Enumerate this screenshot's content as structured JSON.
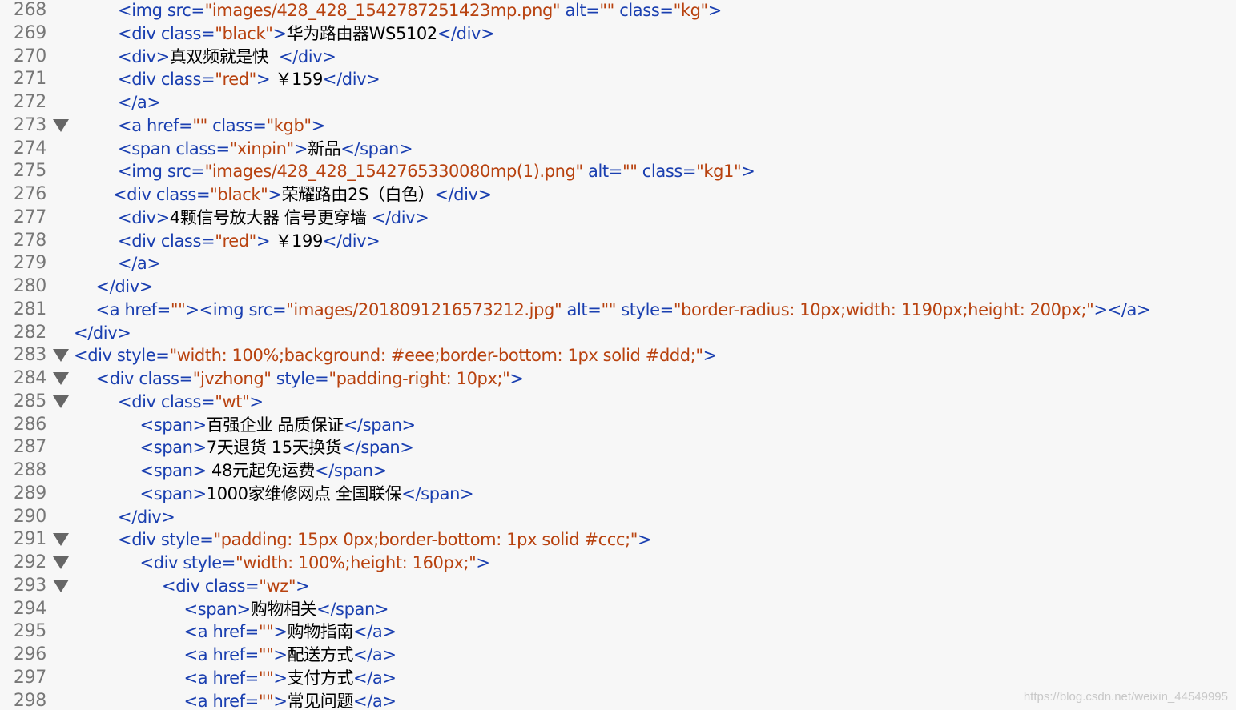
{
  "colors": {
    "background": "#f7f7f7",
    "line_number": "#777777",
    "tag": "#1a3fb0",
    "string": "#b8420f",
    "text": "#000000",
    "watermark": "#c8c8c8"
  },
  "icons": {
    "fold_marker": "fold-triangle-icon"
  },
  "editor": {
    "lines": [
      {
        "num": "268",
        "fold": false,
        "indent": 2,
        "tokens": [
          [
            "tag",
            "<img "
          ],
          [
            "attr",
            "src="
          ],
          [
            "str",
            "\"images/428_428_1542787251423mp.png\""
          ],
          [
            "attr",
            " alt="
          ],
          [
            "str",
            "\"\""
          ],
          [
            "attr",
            " class="
          ],
          [
            "str",
            "\"kg\""
          ],
          [
            "tag",
            ">"
          ]
        ]
      },
      {
        "num": "269",
        "fold": false,
        "indent": 2,
        "tokens": [
          [
            "tag",
            "<div "
          ],
          [
            "attr",
            "class="
          ],
          [
            "str",
            "\"black\""
          ],
          [
            "tag",
            ">"
          ],
          [
            "txt",
            "华为路由器WS5102"
          ],
          [
            "tag",
            "</div>"
          ]
        ]
      },
      {
        "num": "270",
        "fold": false,
        "indent": 2,
        "tokens": [
          [
            "tag",
            "<div>"
          ],
          [
            "txt",
            "真双频就是快  "
          ],
          [
            "tag",
            "</div>"
          ]
        ]
      },
      {
        "num": "271",
        "fold": false,
        "indent": 2,
        "tokens": [
          [
            "tag",
            "<div "
          ],
          [
            "attr",
            "class="
          ],
          [
            "str",
            "\"red\""
          ],
          [
            "tag",
            "> "
          ],
          [
            "txt",
            "￥159"
          ],
          [
            "tag",
            "</div>"
          ]
        ]
      },
      {
        "num": "272",
        "fold": false,
        "indent": 2,
        "tokens": [
          [
            "tag",
            "</a>"
          ]
        ]
      },
      {
        "num": "273",
        "fold": true,
        "indent": 2,
        "tokens": [
          [
            "tag",
            "<a "
          ],
          [
            "attr",
            "href="
          ],
          [
            "str",
            "\"\""
          ],
          [
            "attr",
            " class="
          ],
          [
            "str",
            "\"kgb\""
          ],
          [
            "tag",
            ">"
          ]
        ]
      },
      {
        "num": "274",
        "fold": false,
        "indent": 2,
        "tokens": [
          [
            "tag",
            "<span "
          ],
          [
            "attr",
            "class="
          ],
          [
            "str",
            "\"xinpin\""
          ],
          [
            "tag",
            ">"
          ],
          [
            "txt",
            "新品"
          ],
          [
            "tag",
            "</span>"
          ]
        ]
      },
      {
        "num": "275",
        "fold": false,
        "indent": 2,
        "tokens": [
          [
            "tag",
            "<img "
          ],
          [
            "attr",
            "src="
          ],
          [
            "str",
            "\"images/428_428_1542765330080mp(1).png\""
          ],
          [
            "attr",
            " alt="
          ],
          [
            "str",
            "\"\""
          ],
          [
            "attr",
            " class="
          ],
          [
            "str",
            "\"kg1\""
          ],
          [
            "tag",
            ">"
          ]
        ]
      },
      {
        "num": "276",
        "fold": false,
        "indent": 1.78,
        "tokens": [
          [
            "tag",
            "<div "
          ],
          [
            "attr",
            "class="
          ],
          [
            "str",
            "\"black\""
          ],
          [
            "tag",
            ">"
          ],
          [
            "txt",
            "荣耀路由2S（白色）"
          ],
          [
            "tag",
            "</div>"
          ]
        ]
      },
      {
        "num": "277",
        "fold": false,
        "indent": 2,
        "tokens": [
          [
            "tag",
            "<div>"
          ],
          [
            "txt",
            "4颗信号放大器 信号更穿墙 "
          ],
          [
            "tag",
            "</div>"
          ]
        ]
      },
      {
        "num": "278",
        "fold": false,
        "indent": 2,
        "tokens": [
          [
            "tag",
            "<div "
          ],
          [
            "attr",
            "class="
          ],
          [
            "str",
            "\"red\""
          ],
          [
            "tag",
            "> "
          ],
          [
            "txt",
            "￥199"
          ],
          [
            "tag",
            "</div>"
          ]
        ]
      },
      {
        "num": "279",
        "fold": false,
        "indent": 2,
        "tokens": [
          [
            "tag",
            "</a>"
          ]
        ]
      },
      {
        "num": "280",
        "fold": false,
        "indent": 1,
        "tokens": [
          [
            "tag",
            "</div>"
          ]
        ]
      },
      {
        "num": "281",
        "fold": false,
        "indent": 1,
        "tokens": [
          [
            "tag",
            "<a "
          ],
          [
            "attr",
            "href="
          ],
          [
            "str",
            "\"\""
          ],
          [
            "tag",
            "><img "
          ],
          [
            "attr",
            "src="
          ],
          [
            "str",
            "\"images/2018091216573212.jpg\""
          ],
          [
            "attr",
            " alt="
          ],
          [
            "str",
            "\"\""
          ],
          [
            "attr",
            " style="
          ],
          [
            "str",
            "\"border-radius: 10px;width: 1190px;height: 200px;\""
          ],
          [
            "tag",
            "></a>"
          ]
        ]
      },
      {
        "num": "282",
        "fold": false,
        "indent": 0,
        "tokens": [
          [
            "tag",
            "</div>"
          ]
        ]
      },
      {
        "num": "283",
        "fold": true,
        "indent": 0,
        "tokens": [
          [
            "tag",
            "<div "
          ],
          [
            "attr",
            "style="
          ],
          [
            "str",
            "\"width: 100%;background: #eee;border-bottom: 1px solid #ddd;\""
          ],
          [
            "tag",
            ">"
          ]
        ]
      },
      {
        "num": "284",
        "fold": true,
        "indent": 1,
        "tokens": [
          [
            "tag",
            "<div "
          ],
          [
            "attr",
            "class="
          ],
          [
            "str",
            "\"jvzhong\""
          ],
          [
            "attr",
            " style="
          ],
          [
            "str",
            "\"padding-right: 10px;\""
          ],
          [
            "tag",
            ">"
          ]
        ]
      },
      {
        "num": "285",
        "fold": true,
        "indent": 2,
        "tokens": [
          [
            "tag",
            "<div "
          ],
          [
            "attr",
            "class="
          ],
          [
            "str",
            "\"wt\""
          ],
          [
            "tag",
            ">"
          ]
        ]
      },
      {
        "num": "286",
        "fold": false,
        "indent": 3,
        "tokens": [
          [
            "tag",
            "<span>"
          ],
          [
            "txt",
            "百强企业 品质保证"
          ],
          [
            "tag",
            "</span>"
          ]
        ]
      },
      {
        "num": "287",
        "fold": false,
        "indent": 3,
        "tokens": [
          [
            "tag",
            "<span>"
          ],
          [
            "txt",
            "7天退货 15天换货"
          ],
          [
            "tag",
            "</span>"
          ]
        ]
      },
      {
        "num": "288",
        "fold": false,
        "indent": 3,
        "tokens": [
          [
            "tag",
            "<span> "
          ],
          [
            "txt",
            "48元起免运费"
          ],
          [
            "tag",
            "</span>"
          ]
        ]
      },
      {
        "num": "289",
        "fold": false,
        "indent": 3,
        "tokens": [
          [
            "tag",
            "<span>"
          ],
          [
            "txt",
            "1000家维修网点 全国联保"
          ],
          [
            "tag",
            "</span>"
          ]
        ]
      },
      {
        "num": "290",
        "fold": false,
        "indent": 2,
        "tokens": [
          [
            "tag",
            "</div>"
          ]
        ]
      },
      {
        "num": "291",
        "fold": true,
        "indent": 2,
        "tokens": [
          [
            "tag",
            "<div "
          ],
          [
            "attr",
            "style="
          ],
          [
            "str",
            "\"padding: 15px 0px;border-bottom: 1px solid #ccc;\""
          ],
          [
            "tag",
            ">"
          ]
        ]
      },
      {
        "num": "292",
        "fold": true,
        "indent": 3,
        "tokens": [
          [
            "tag",
            "<div "
          ],
          [
            "attr",
            "style="
          ],
          [
            "str",
            "\"width: 100%;height: 160px;\""
          ],
          [
            "tag",
            ">"
          ]
        ]
      },
      {
        "num": "293",
        "fold": true,
        "indent": 4,
        "tokens": [
          [
            "tag",
            "<div "
          ],
          [
            "attr",
            "class="
          ],
          [
            "str",
            "\"wz\""
          ],
          [
            "tag",
            ">"
          ]
        ]
      },
      {
        "num": "294",
        "fold": false,
        "indent": 5,
        "tokens": [
          [
            "tag",
            "<span>"
          ],
          [
            "txt",
            "购物相关"
          ],
          [
            "tag",
            "</span>"
          ]
        ]
      },
      {
        "num": "295",
        "fold": false,
        "indent": 5,
        "tokens": [
          [
            "tag",
            "<a "
          ],
          [
            "attr",
            "href="
          ],
          [
            "str",
            "\"\""
          ],
          [
            "tag",
            ">"
          ],
          [
            "txt",
            "购物指南"
          ],
          [
            "tag",
            "</a>"
          ]
        ]
      },
      {
        "num": "296",
        "fold": false,
        "indent": 5,
        "tokens": [
          [
            "tag",
            "<a "
          ],
          [
            "attr",
            "href="
          ],
          [
            "str",
            "\"\""
          ],
          [
            "tag",
            ">"
          ],
          [
            "txt",
            "配送方式"
          ],
          [
            "tag",
            "</a>"
          ]
        ]
      },
      {
        "num": "297",
        "fold": false,
        "indent": 5,
        "tokens": [
          [
            "tag",
            "<a "
          ],
          [
            "attr",
            "href="
          ],
          [
            "str",
            "\"\""
          ],
          [
            "tag",
            ">"
          ],
          [
            "txt",
            "支付方式"
          ],
          [
            "tag",
            "</a>"
          ]
        ]
      },
      {
        "num": "298",
        "fold": false,
        "indent": 5,
        "tokens": [
          [
            "tag",
            "<a "
          ],
          [
            "attr",
            "href="
          ],
          [
            "str",
            "\"\""
          ],
          [
            "tag",
            ">"
          ],
          [
            "txt",
            "常见问题"
          ],
          [
            "tag",
            "</a>"
          ]
        ]
      }
    ]
  },
  "watermark": {
    "text": "https://blog.csdn.net/weixin_44549995"
  }
}
